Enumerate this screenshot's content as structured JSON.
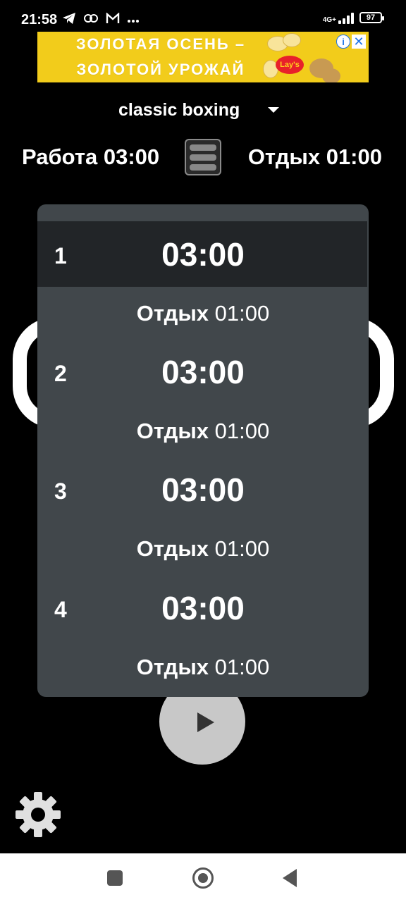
{
  "status_bar": {
    "time": "21:58",
    "network": "4G+",
    "battery": "97",
    "icons": [
      "telegram-icon",
      "link-icon",
      "gmail-icon",
      "more-icon"
    ]
  },
  "ad": {
    "line1": "ЗОЛОТАЯ ОСЕНЬ –",
    "line2": "ЗОЛОТОЙ УРОЖАЙ",
    "brand": "Lay's",
    "info": "i",
    "close": "✕"
  },
  "preset": {
    "label": "classic boxing"
  },
  "summary": {
    "work": "Работа 03:00",
    "rest": "Отдых 01:00"
  },
  "rounds": [
    {
      "number": "1",
      "time": "03:00",
      "rest_label": "Отдых",
      "rest_time": "01:00"
    },
    {
      "number": "2",
      "time": "03:00",
      "rest_label": "Отдых",
      "rest_time": "01:00"
    },
    {
      "number": "3",
      "time": "03:00",
      "rest_label": "Отдых",
      "rest_time": "01:00"
    },
    {
      "number": "4",
      "time": "03:00",
      "rest_label": "Отдых",
      "rest_time": "01:00"
    }
  ],
  "colors": {
    "background": "#000000",
    "panel": "#41474b",
    "active_row": "#222528",
    "ad_yellow": "#f2cc1b",
    "play_button": "#c8c8c8"
  }
}
